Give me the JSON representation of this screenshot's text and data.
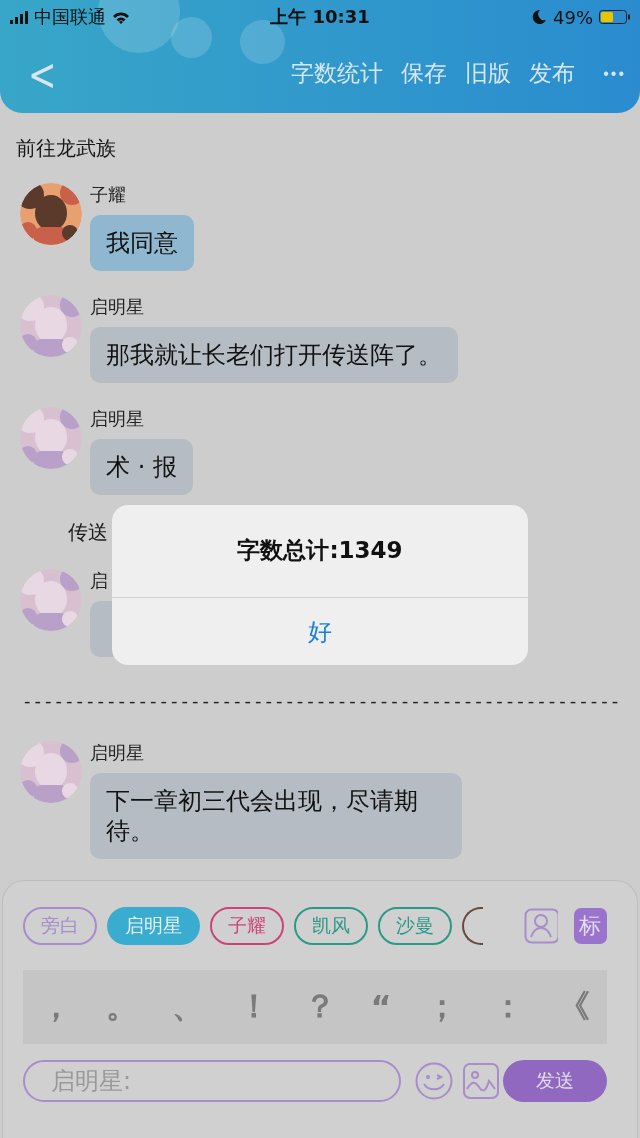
{
  "status_bar": {
    "carrier": "中国联通",
    "time": "上午 10:31",
    "battery": "49%"
  },
  "nav_bar": {
    "back": "<",
    "actions": [
      "字数统计",
      "保存",
      "旧版",
      "发布"
    ],
    "more": "•••"
  },
  "chat": [
    {
      "kind": "narration",
      "text": "前往龙武族"
    },
    {
      "kind": "message",
      "speaker": "子耀",
      "text": "我同意",
      "color": "#8fb7cf"
    },
    {
      "kind": "message",
      "speaker": "启明星",
      "text": "那我就让长老们打开传送阵了。",
      "color": "#b6bcc4"
    },
    {
      "kind": "message",
      "speaker": "启明星",
      "text": "术 · 报",
      "color": "#b6bcc4"
    },
    {
      "kind": "indented_narration",
      "text": "传送"
    },
    {
      "kind": "message",
      "speaker": "启",
      "color": "#b6bcc4"
    },
    {
      "kind": "rule",
      "text": "---------------------------------------------------------"
    },
    {
      "kind": "message",
      "speaker": "启明星",
      "text": "下一章初三代会出现，尽请期待。",
      "color": "#b6bcc4"
    }
  ],
  "role_chips": [
    {
      "label": "旁白",
      "color": "#a88ccc",
      "selected": false
    },
    {
      "label": "启明星",
      "color": "#3aaccf",
      "selected": true
    },
    {
      "label": "子耀",
      "color": "#cc4477",
      "selected": false
    },
    {
      "label": "凯风",
      "color": "#2a9a88",
      "selected": false
    },
    {
      "label": "沙曼",
      "color": "#2a9a88",
      "selected": false
    },
    {
      "color": "#6a4a3a",
      "selected": false
    }
  ],
  "tag_button": "标",
  "punctuation": [
    "，",
    "。",
    "、",
    "！",
    "？",
    "“",
    "；",
    "：",
    "《"
  ],
  "input": {
    "placeholder": "启明星:"
  },
  "send_button": "发送",
  "alert": {
    "title": "字数总计:1349",
    "button": "好"
  }
}
